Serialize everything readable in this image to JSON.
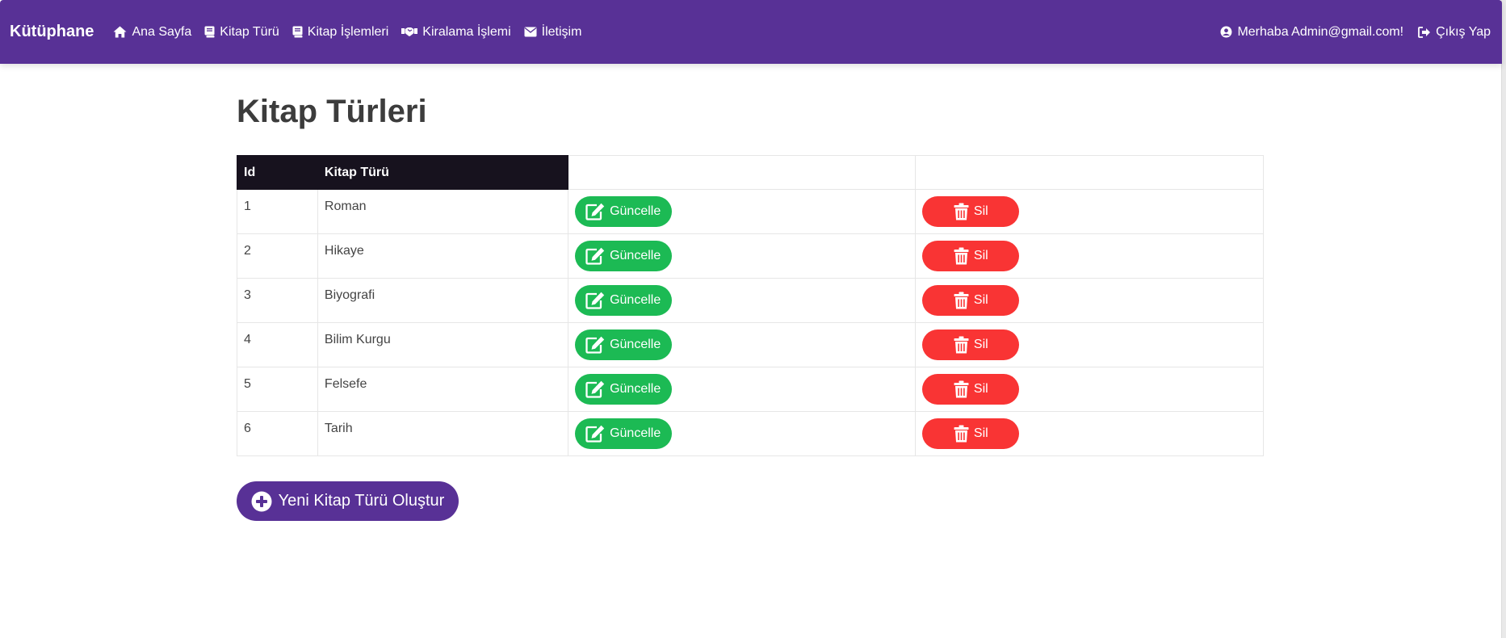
{
  "navbar": {
    "brand": "Kütüphane",
    "items": [
      {
        "label": "Ana Sayfa",
        "icon": "home-icon"
      },
      {
        "label": "Kitap Türü",
        "icon": "book-icon"
      },
      {
        "label": "Kitap İşlemleri",
        "icon": "book-icon"
      },
      {
        "label": "Kiralama İşlemi",
        "icon": "handshake-icon"
      },
      {
        "label": "İletişim",
        "icon": "envelope-icon"
      }
    ],
    "greeting": "Merhaba Admin@gmail.com!",
    "logout": "Çıkış Yap",
    "background_color": "#583196"
  },
  "page": {
    "title": "Kitap Türleri"
  },
  "table": {
    "headers": {
      "id": "Id",
      "name": "Kitap Türü"
    },
    "rows": [
      {
        "id": "1",
        "name": "Roman"
      },
      {
        "id": "2",
        "name": "Hikaye"
      },
      {
        "id": "3",
        "name": "Biyografi"
      },
      {
        "id": "4",
        "name": "Bilim Kurgu"
      },
      {
        "id": "5",
        "name": "Felsefe"
      },
      {
        "id": "6",
        "name": "Tarih"
      }
    ],
    "update_label": "Güncelle",
    "delete_label": "Sil",
    "update_color": "#1cba54",
    "delete_color": "#f93434"
  },
  "actions": {
    "create_label": "Yeni Kitap Türü Oluştur"
  }
}
